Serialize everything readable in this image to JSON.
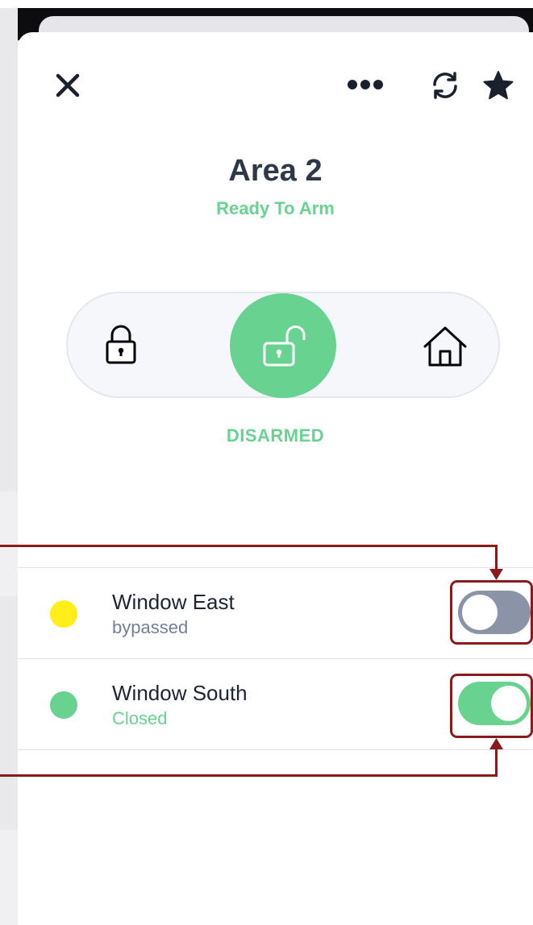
{
  "header": {
    "close_icon": "close-icon",
    "more_icon": "more-horizontal-icon",
    "refresh_icon": "refresh-icon",
    "favorite_icon": "star-icon"
  },
  "area": {
    "title": "Area 2",
    "subtitle": "Ready To Arm"
  },
  "modes": {
    "items": [
      {
        "name": "away",
        "icon": "lock-icon",
        "active": false
      },
      {
        "name": "disarm",
        "icon": "unlock-icon",
        "active": true
      },
      {
        "name": "stay",
        "icon": "home-icon",
        "active": false
      }
    ],
    "status": "DISARMED"
  },
  "zones": [
    {
      "name": "Window East",
      "status": "bypassed",
      "dot_color": "#ffee18",
      "status_color": "#718096",
      "toggle_on": false
    },
    {
      "name": "Window South",
      "status": "Closed",
      "dot_color": "#68d391",
      "status_color": "#68d391",
      "toggle_on": true
    }
  ],
  "colors": {
    "accent": "#68d391",
    "title": "#2e3847",
    "toggle_off": "#8a94a6",
    "annotation": "#8b1a1a"
  }
}
